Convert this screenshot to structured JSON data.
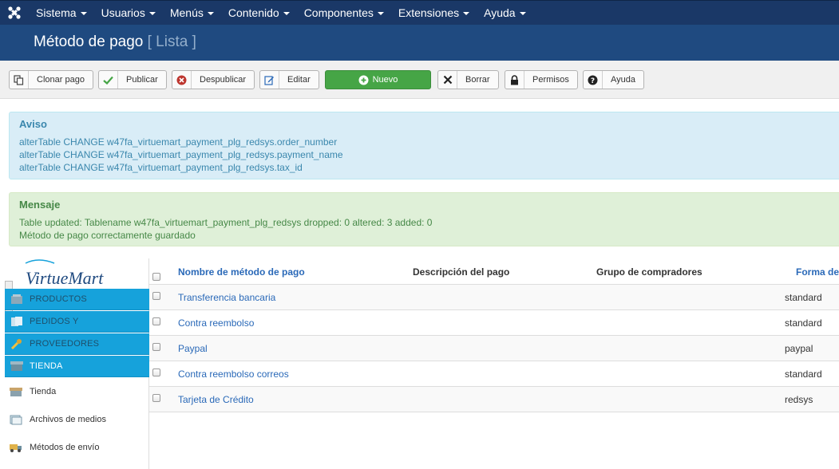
{
  "topnav": {
    "items": [
      "Sistema",
      "Usuarios",
      "Menús",
      "Contenido",
      "Componentes",
      "Extensiones",
      "Ayuda"
    ]
  },
  "header": {
    "title": "Método de pago",
    "subtitle": "[ Lista ]"
  },
  "toolbar": {
    "clone_label": "Clonar pago",
    "publish_label": "Publicar",
    "unpublish_label": "Despublicar",
    "edit_label": "Editar",
    "new_label": "Nuevo",
    "delete_label": "Borrar",
    "permissions_label": "Permisos",
    "help_label": "Ayuda"
  },
  "notice": {
    "heading": "Aviso",
    "lines": [
      "alterTable CHANGE w47fa_virtuemart_payment_plg_redsys.order_number",
      "alterTable CHANGE w47fa_virtuemart_payment_plg_redsys.payment_name",
      "alterTable CHANGE w47fa_virtuemart_payment_plg_redsys.tax_id"
    ]
  },
  "message": {
    "heading": "Mensaje",
    "lines": [
      "Table updated: Tablename w47fa_virtuemart_payment_plg_redsys dropped: 0 altered: 3 added: 0",
      "Método de pago correctamente guardado"
    ]
  },
  "sidebar": {
    "categories": [
      "PRODUCTOS",
      "PEDIDOS Y",
      "PROVEEDORES",
      "TIENDA"
    ],
    "items": [
      "Tienda",
      "Archivos de medios",
      "Métodos de envío"
    ]
  },
  "table": {
    "headers": [
      "Nombre de método de pago",
      "Descripción del pago",
      "Grupo de compradores",
      "Forma de"
    ],
    "rows": [
      {
        "name": "Transferencia bancaria",
        "form": "standard"
      },
      {
        "name": "Contra reembolso",
        "form": "standard"
      },
      {
        "name": "Paypal",
        "form": "paypal"
      },
      {
        "name": "Contra reembolso correos",
        "form": "standard"
      },
      {
        "name": "Tarjeta de Crédito",
        "form": "redsys"
      }
    ]
  },
  "colors": {
    "nav_bg": "#1a3867",
    "header_bg": "#1f4a80",
    "accent_green": "#46a546",
    "vm_blue": "#16a2db",
    "link": "#2a69b8"
  }
}
